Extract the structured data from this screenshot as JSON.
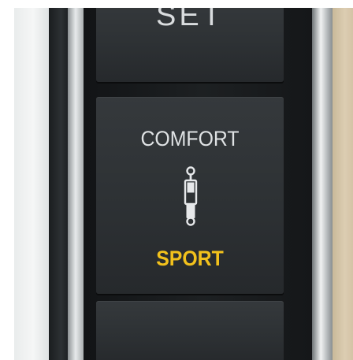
{
  "buttons": {
    "top": {
      "label": "SET"
    },
    "middle": {
      "upper_label": "COMFORT",
      "lower_label": "SPORT",
      "icon": "shock-absorber-icon"
    },
    "bottom": {
      "label": ""
    }
  },
  "colors": {
    "sport_text": "#f2c11c",
    "comfort_text": "#dfe2e4",
    "button_face": "#2f3336",
    "panel": "#17191b"
  }
}
